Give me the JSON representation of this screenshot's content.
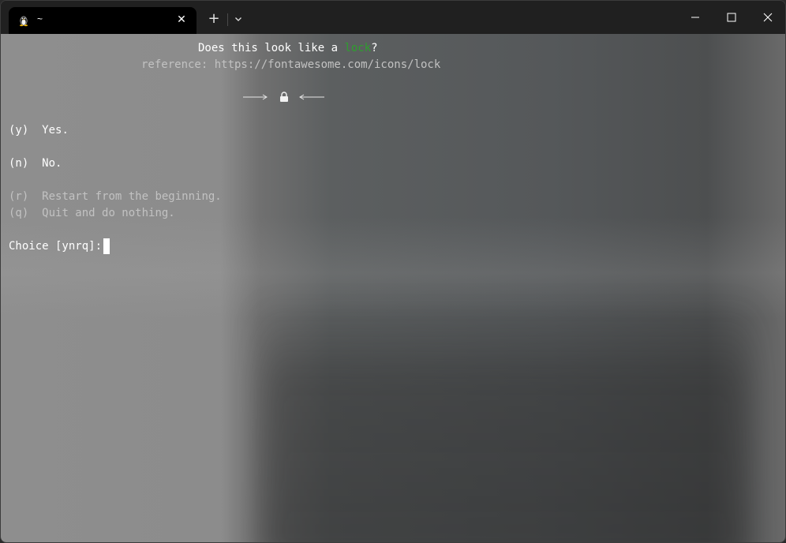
{
  "tab": {
    "icon": "linux-penguin-icon",
    "title": "~"
  },
  "titlebar": {
    "new_tab_label": "+",
    "close_label": "✕"
  },
  "terminal": {
    "question_prefix": "Does this look like a ",
    "question_keyword": "lock",
    "question_suffix": "?",
    "reference_line": "reference: https://fontawesome.com/icons/lock",
    "preview_icon": "lock-icon",
    "options": [
      {
        "key": "(y)",
        "label": "Yes."
      },
      {
        "key": "(n)",
        "label": "No."
      },
      {
        "key": "(r)",
        "label": "Restart from the beginning."
      },
      {
        "key": "(q)",
        "label": "Quit and do nothing."
      }
    ],
    "prompt": "Choice [ynrq]: "
  },
  "colors": {
    "keyword": "#2e9e2e",
    "text": "#ffffff",
    "dim_text": "#c2c2c2",
    "titlebar": "#202020",
    "tab": "#000000"
  }
}
